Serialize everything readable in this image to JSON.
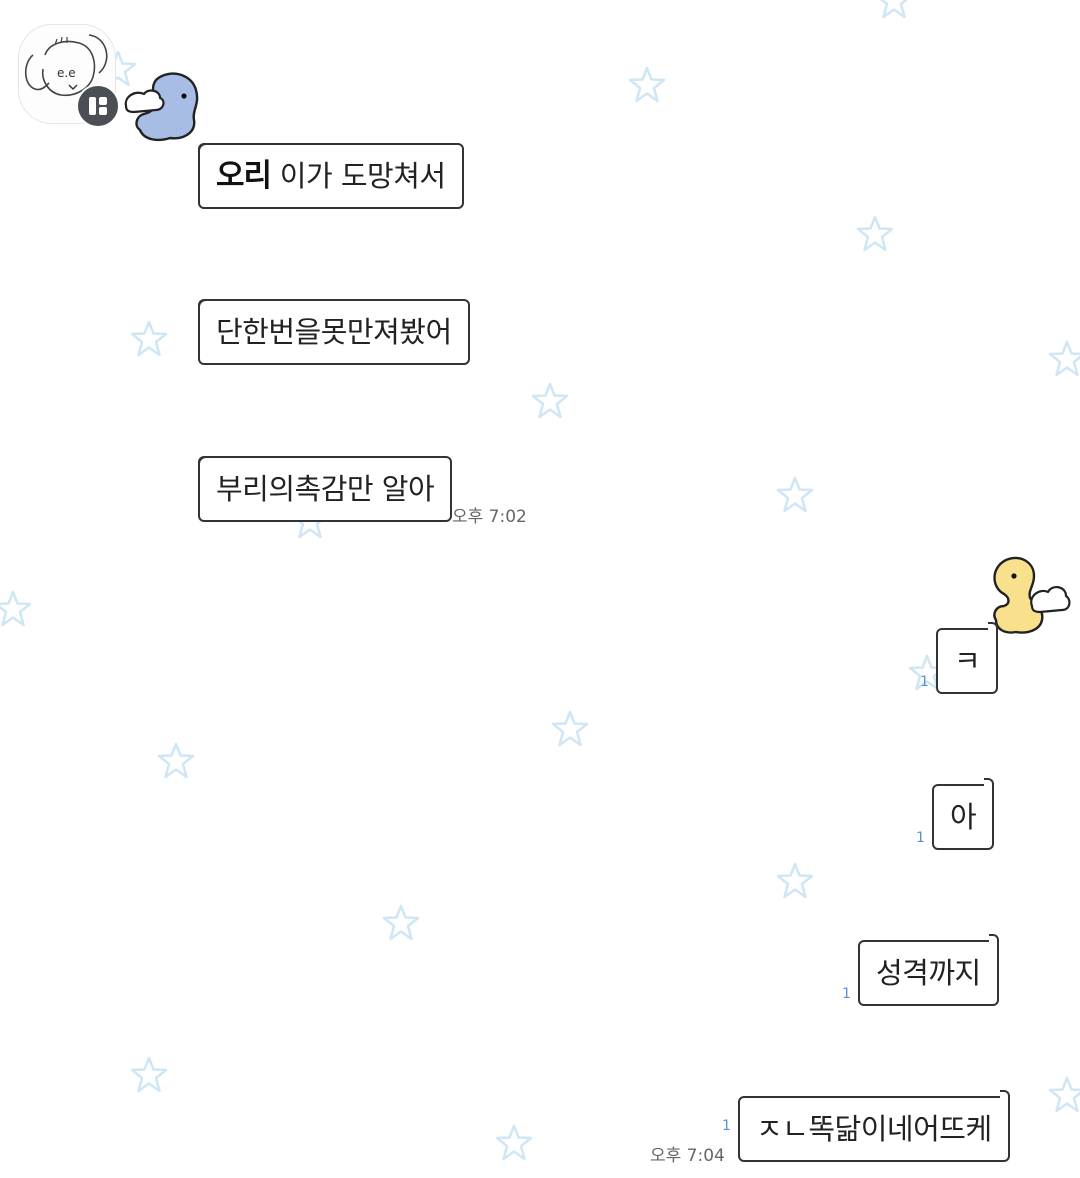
{
  "colors": {
    "background": "#ffffff",
    "star_outline": "#cfe6f5",
    "bubble_border": "#333333",
    "read_count": "#5b8fd8",
    "left_character": "#a7bde6",
    "right_character": "#f8e08c"
  },
  "incoming": {
    "avatar_icon": "doodle-animal-avatar",
    "badge_icon": "app-badge-icon",
    "sticker_icon": "blue-winged-chick-sticker",
    "messages": [
      {
        "name_tag": "오리",
        "text": "이가 도망쳐서"
      },
      {
        "text": "단한번을못만져봤어"
      },
      {
        "text": "부리의촉감만 알아"
      }
    ],
    "time": "오후 7:02"
  },
  "outgoing": {
    "sticker_icon": "yellow-winged-chick-sticker",
    "messages": [
      {
        "text": "ㅋ",
        "read": "1"
      },
      {
        "text": "아",
        "read": "1"
      },
      {
        "text": "성격까지",
        "read": "1"
      },
      {
        "text": "ㅈㄴ똑닮이네어뜨케",
        "read": "1"
      }
    ],
    "time": "오후 7:04"
  }
}
